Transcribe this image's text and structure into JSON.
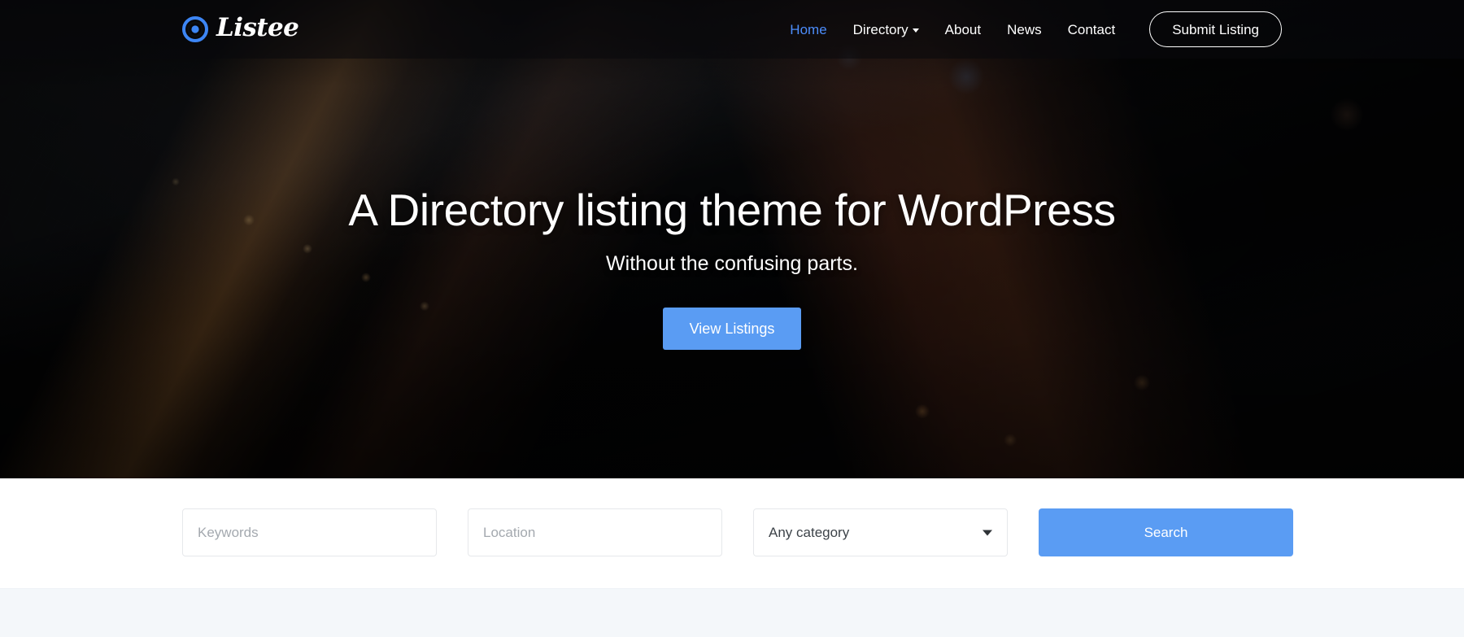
{
  "brand": {
    "name": "Listee",
    "logo_icon": "target-circle-icon",
    "accent_color": "#4c8dfb"
  },
  "header": {
    "nav": [
      {
        "label": "Home",
        "active": true,
        "has_dropdown": false
      },
      {
        "label": "Directory",
        "active": false,
        "has_dropdown": true
      },
      {
        "label": "About",
        "active": false,
        "has_dropdown": false
      },
      {
        "label": "News",
        "active": false,
        "has_dropdown": false
      },
      {
        "label": "Contact",
        "active": false,
        "has_dropdown": false
      }
    ],
    "submit_label": "Submit Listing"
  },
  "hero": {
    "title": "A Directory listing theme for WordPress",
    "subtitle": "Without the confusing parts.",
    "cta_label": "View Listings",
    "cta_color": "#5a9cf3",
    "background": "aerial-night-city-photo"
  },
  "search": {
    "keywords_placeholder": "Keywords",
    "keywords_value": "",
    "location_placeholder": "Location",
    "location_value": "",
    "category_selected": "Any category",
    "category_options": [
      "Any category"
    ],
    "search_label": "Search",
    "search_color": "#5a9cf3"
  },
  "lower_section": {
    "background_color": "#f4f7fa"
  }
}
